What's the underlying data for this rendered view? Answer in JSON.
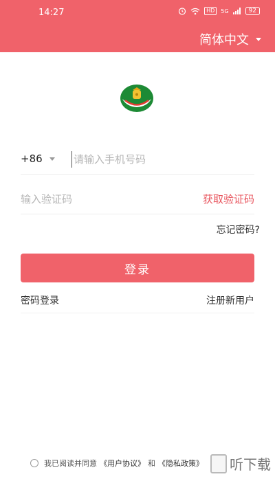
{
  "status_bar": {
    "time": "14:27",
    "hd": "HD",
    "signal": "5G",
    "battery": "92"
  },
  "header": {
    "language": "简体中文"
  },
  "form": {
    "country_code": "+86",
    "phone_placeholder": "请输入手机号码",
    "code_placeholder": "输入验证码",
    "get_code_label": "获取验证码",
    "forgot_label": "忘记密码?",
    "login_label": "登录",
    "password_login_label": "密码登录",
    "register_label": "注册新用户"
  },
  "agreement": {
    "prefix": "我已阅读并同意",
    "user_agreement": "《用户协议》",
    "conjunction": "和",
    "privacy_policy": "《隐私政策》"
  },
  "watermark": {
    "text": "听下载"
  },
  "colors": {
    "accent": "#f0626a",
    "link_red": "#e8545d"
  }
}
